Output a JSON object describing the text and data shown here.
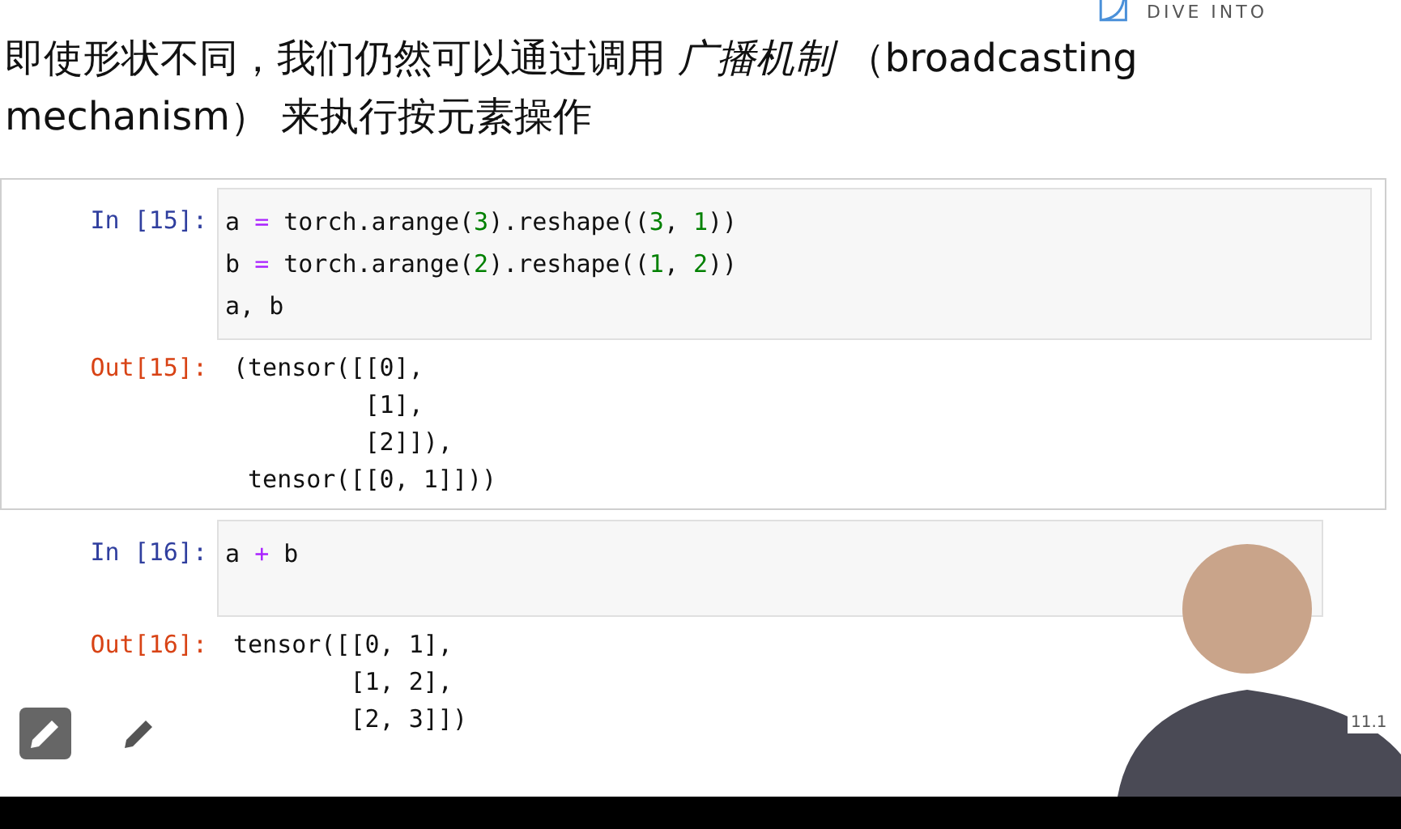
{
  "heading": {
    "text": "即使形状不同，我们仍然可以通过调用 *广播机制* （broadcasting mechanism） 来执行按元素操作"
  },
  "logo": {
    "text": "DIVE INTO"
  },
  "cells": [
    {
      "prompt_in": "In [15]:",
      "selected": true,
      "code": [
        [
          {
            "t": "a ",
            "kind": "plain"
          },
          {
            "t": "=",
            "kind": "op"
          },
          {
            "t": " torch.arange(",
            "kind": "plain"
          },
          {
            "t": "3",
            "kind": "num"
          },
          {
            "t": ").reshape((",
            "kind": "plain"
          },
          {
            "t": "3",
            "kind": "num"
          },
          {
            "t": ", ",
            "kind": "plain"
          },
          {
            "t": "1",
            "kind": "num"
          },
          {
            "t": "))",
            "kind": "plain"
          }
        ],
        [
          {
            "t": "b ",
            "kind": "plain"
          },
          {
            "t": "=",
            "kind": "op"
          },
          {
            "t": " torch.arange(",
            "kind": "plain"
          },
          {
            "t": "2",
            "kind": "num"
          },
          {
            "t": ").reshape((",
            "kind": "plain"
          },
          {
            "t": "1",
            "kind": "num"
          },
          {
            "t": ", ",
            "kind": "plain"
          },
          {
            "t": "2",
            "kind": "num"
          },
          {
            "t": "))",
            "kind": "plain"
          }
        ],
        [
          {
            "t": "a, b",
            "kind": "plain"
          }
        ]
      ],
      "prompt_out": "Out[15]:",
      "output": [
        "(tensor([[0],",
        "         [1],",
        "         [2]]),",
        " tensor([[0, 1]]))"
      ]
    },
    {
      "prompt_in": "In [16]:",
      "selected": false,
      "code": [
        [
          {
            "t": "a ",
            "kind": "plain"
          },
          {
            "t": "+",
            "kind": "op"
          },
          {
            "t": " b",
            "kind": "plain"
          }
        ]
      ],
      "prompt_out": "Out[16]:",
      "output": [
        "tensor([[0, 1],",
        "        [1, 2],",
        "        [2, 3]])"
      ]
    }
  ],
  "slide_number": "11.1"
}
